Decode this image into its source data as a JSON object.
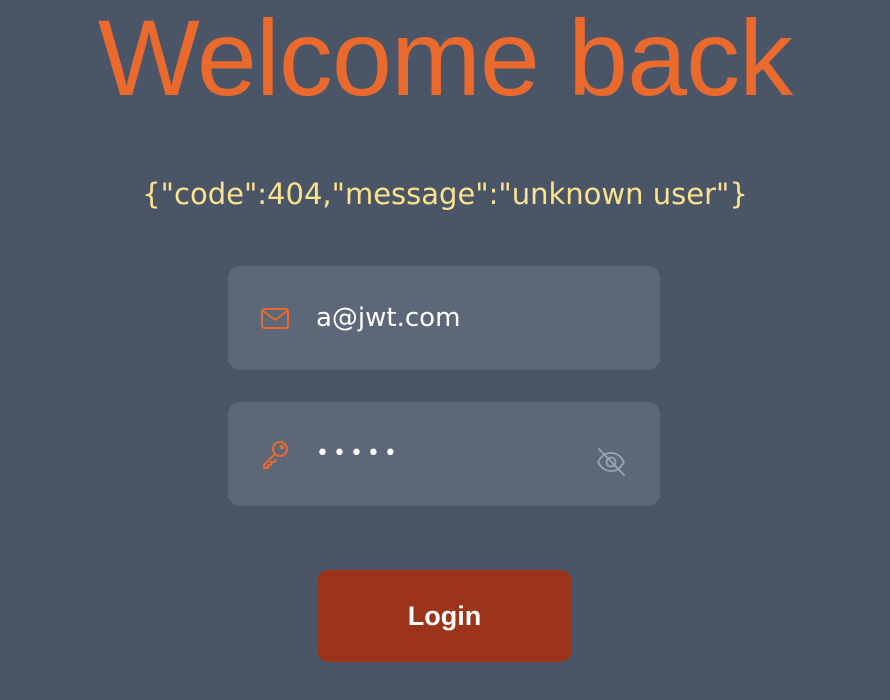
{
  "header": {
    "title": "Welcome back"
  },
  "error": {
    "message": "{\"code\":404,\"message\":\"unknown user\"}"
  },
  "form": {
    "email": {
      "value": "a@jwt.com",
      "icon": "envelope-icon"
    },
    "password": {
      "masked_value": "•••••",
      "icon": "key-icon",
      "toggle_icon": "eye-slash-icon"
    },
    "login_label": "Login"
  },
  "colors": {
    "background": "#4a5568",
    "title": "#ea6a2e",
    "error_text": "#fbe38b",
    "field_background": "#5c6778",
    "icon_accent": "#ea6a2e",
    "toggle_icon": "#9aa3b1",
    "login_button": "#9b341b"
  }
}
